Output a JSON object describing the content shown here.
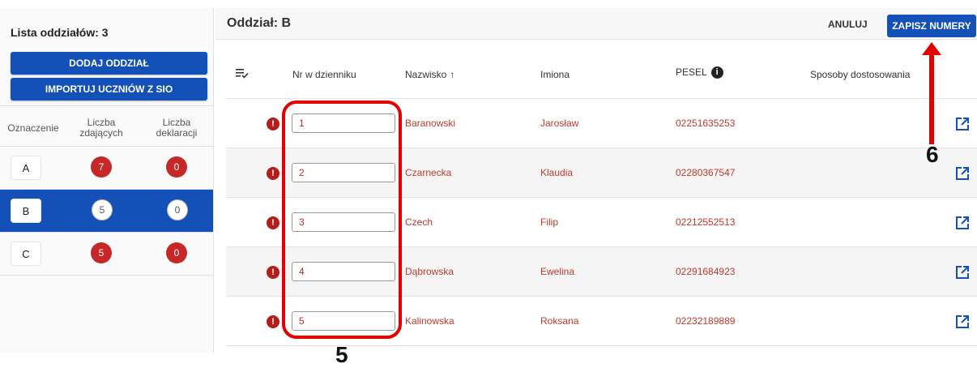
{
  "sidebar": {
    "title": "Lista oddziałów: 3",
    "add_button": "DODAJ ODDZIAŁ",
    "import_button": "IMPORTUJ UCZNIÓW Z SIO",
    "headers": {
      "oznaczenie": "Oznaczenie",
      "zdajacych": "Liczba zdających",
      "deklaracji": "Liczba deklaracji"
    },
    "rows": [
      {
        "letter": "A",
        "zdajacych": "7",
        "deklaracji": "0",
        "selected": false
      },
      {
        "letter": "B",
        "zdajacych": "5",
        "deklaracji": "0",
        "selected": true
      },
      {
        "letter": "C",
        "zdajacych": "5",
        "deklaracji": "0",
        "selected": false
      }
    ]
  },
  "header": {
    "title": "Oddział: B",
    "cancel_label": "ANULUJ",
    "save_label": "ZAPISZ NUMERY"
  },
  "table": {
    "columns": {
      "nr": "Nr w dzienniku",
      "nazwisko": "Nazwisko",
      "imiona": "Imiona",
      "pesel": "PESEL",
      "sposoby": "Sposoby dostosowania"
    },
    "sort_arrow": "↑",
    "info_glyph": "i",
    "error_glyph": "!",
    "rows": [
      {
        "nr": "1",
        "nazwisko": "Baranowski",
        "imiona": "Jarosław",
        "pesel": "02251635253"
      },
      {
        "nr": "2",
        "nazwisko": "Czarnecka",
        "imiona": "Klaudia",
        "pesel": "02280367547"
      },
      {
        "nr": "3",
        "nazwisko": "Czech",
        "imiona": "Filip",
        "pesel": "02212552513"
      },
      {
        "nr": "4",
        "nazwisko": "Dąbrowska",
        "imiona": "Ewelina",
        "pesel": "02291684923"
      },
      {
        "nr": "5",
        "nazwisko": "Kalinowska",
        "imiona": "Roksana",
        "pesel": "02232189889"
      }
    ]
  },
  "annotations": {
    "label_5": "5",
    "label_6": "6"
  },
  "colors": {
    "primary": "#1350b8",
    "error": "#c62828",
    "annotation": "#e40000"
  },
  "icons": [
    "sort-list-icon",
    "info-icon",
    "error-icon",
    "external-link-icon",
    "arrow-up-icon"
  ]
}
